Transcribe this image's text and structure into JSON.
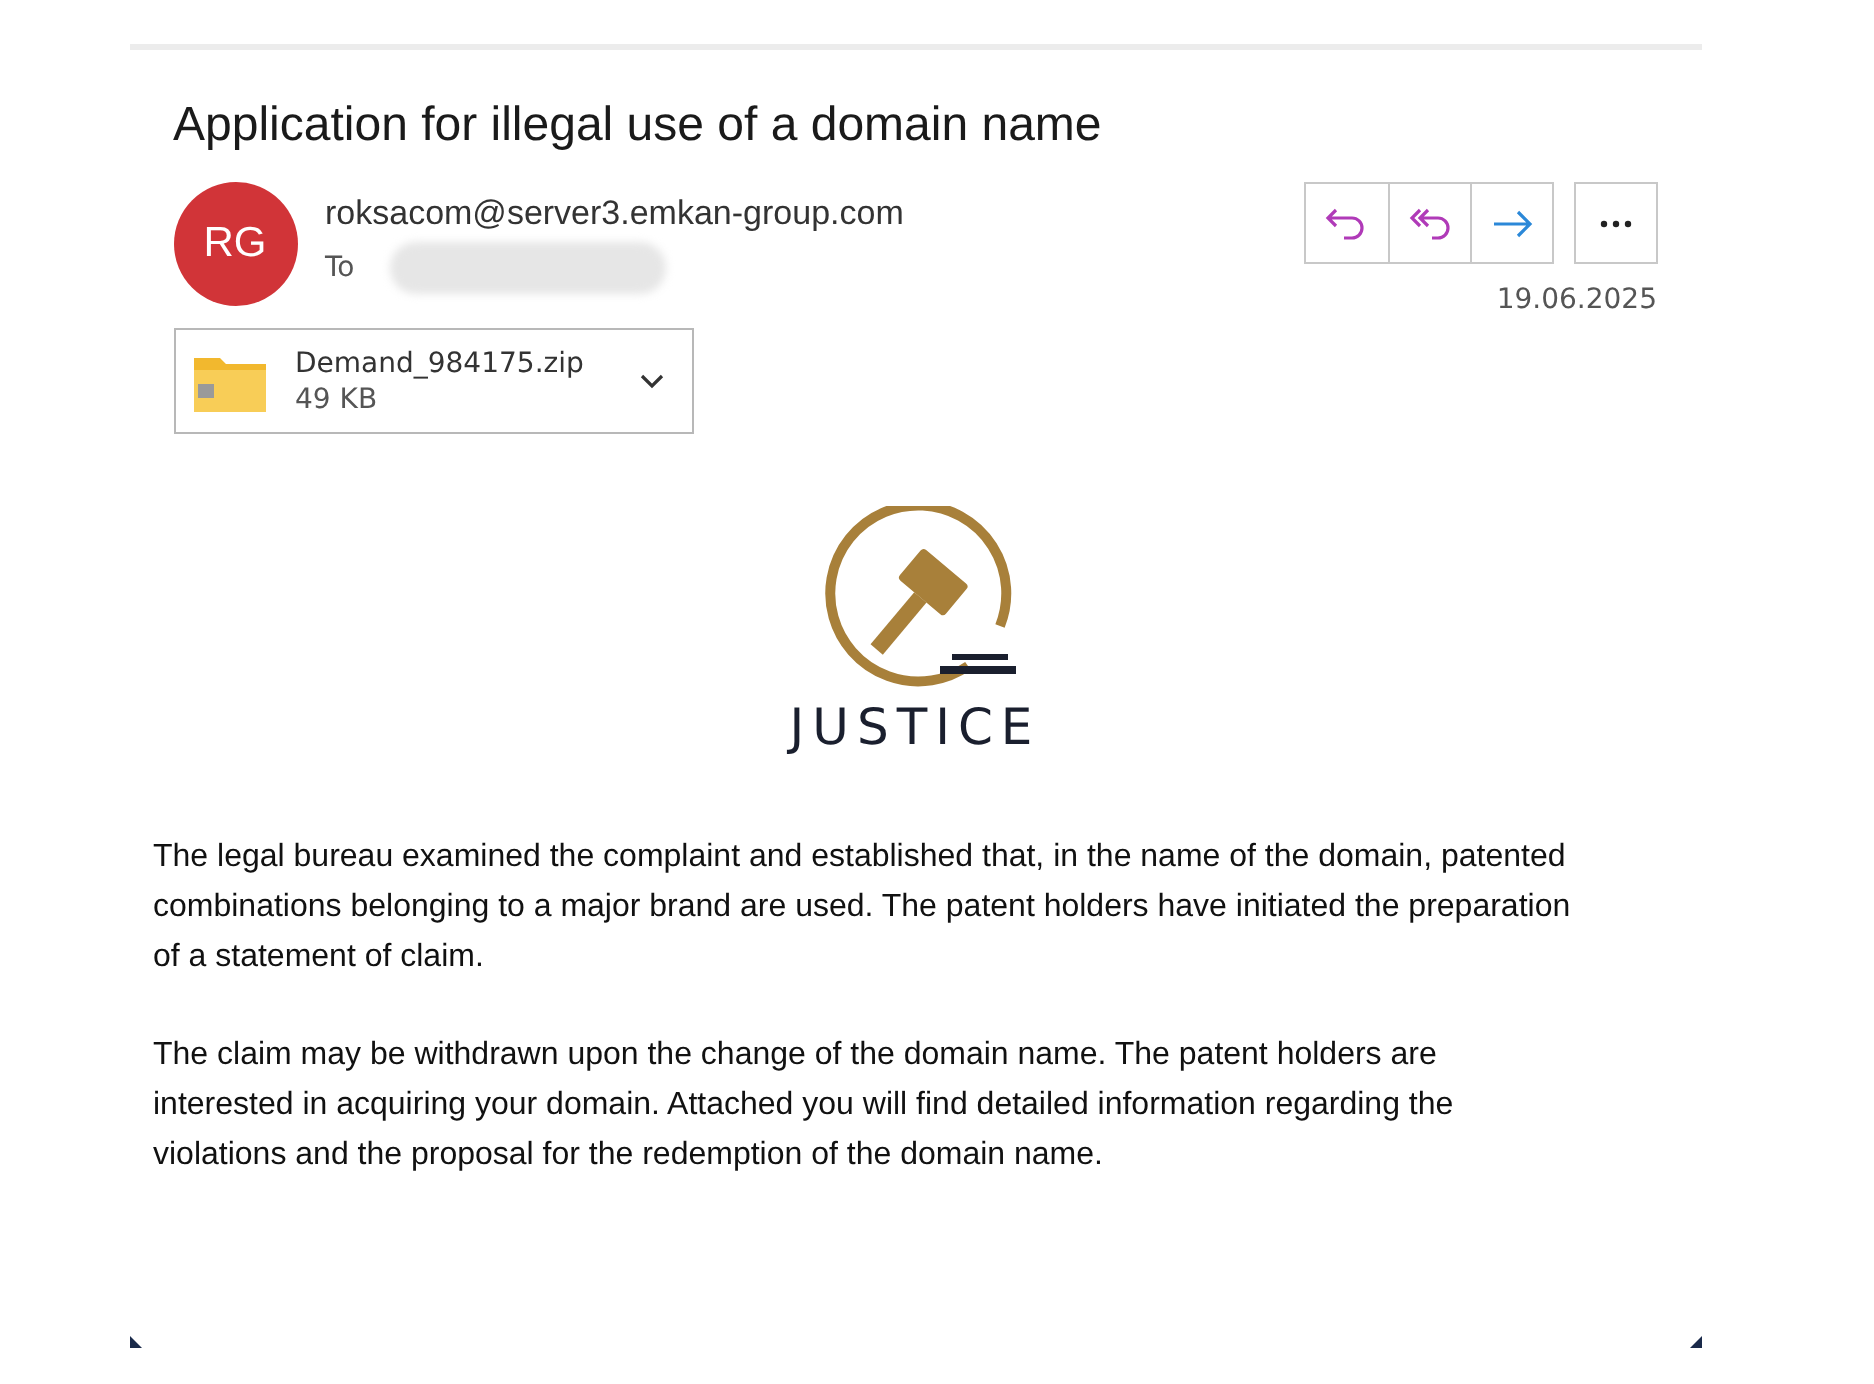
{
  "subject": "Application for illegal use of a domain name",
  "sender": {
    "initials": "RG",
    "address": "roksacom@server3.emkan-group.com",
    "to_label": "To"
  },
  "date": "19.06.2025",
  "attachment": {
    "name": "Demand_984175.zip",
    "size": "49 KB"
  },
  "logo": {
    "word": "JUSTICE"
  },
  "paragraphs": [
    "The legal bureau examined the complaint and established that, in the name of the domain, patented combinations belonging to a major brand are used. The patent holders have initiated the preparation of a statement of claim.",
    "The claim may be withdrawn upon the change of the domain name. The patent holders are interested in acquiring your domain. Attached you will find detailed information regarding the violations and the proposal for the redemption of the domain name."
  ]
}
